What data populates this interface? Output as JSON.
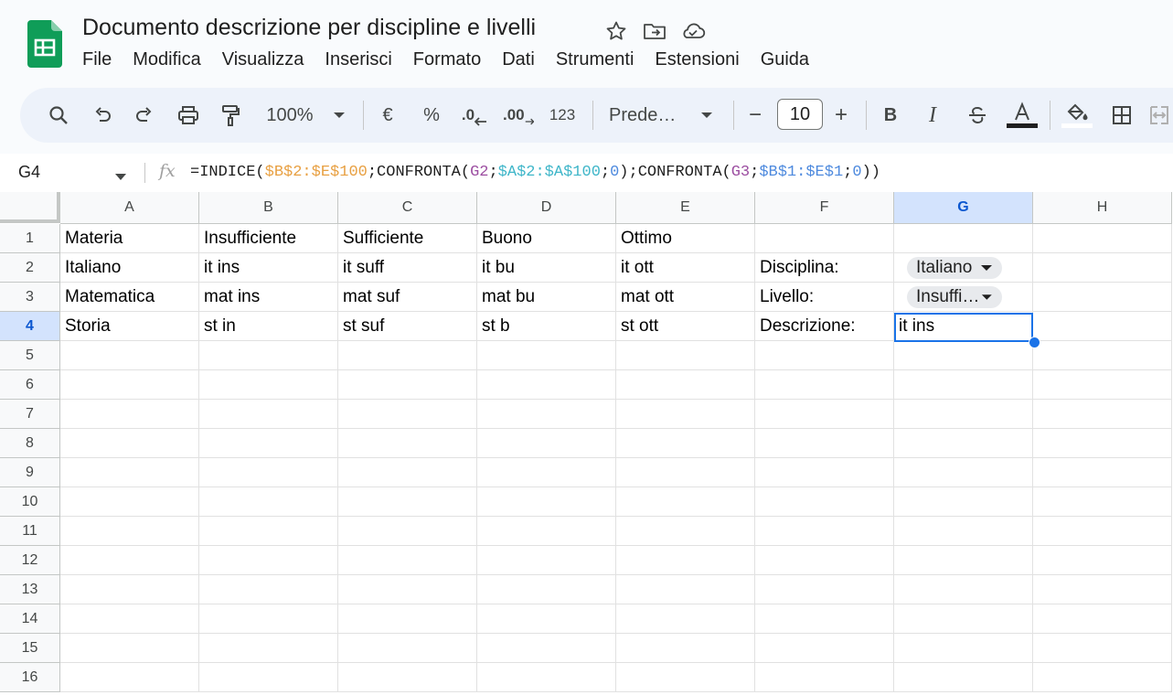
{
  "document": {
    "title": "Documento descrizione per discipline e livelli"
  },
  "menu": [
    "File",
    "Modifica",
    "Visualizza",
    "Inserisci",
    "Formato",
    "Dati",
    "Strumenti",
    "Estensioni",
    "Guida"
  ],
  "toolbar": {
    "zoom": "100%",
    "currency": "€",
    "percent": "%",
    "dec_decrease": ".0",
    "dec_increase": ".00",
    "number_format": "123",
    "font": "Prede…",
    "font_size": "10",
    "minus": "−",
    "plus": "+",
    "bold": "B",
    "italic": "I"
  },
  "formula_bar": {
    "name_box": "G4",
    "fx": "fx",
    "parts": [
      {
        "text": "=INDICE(",
        "color": "dark"
      },
      {
        "text": "$B$2:$E$100",
        "color": "orange"
      },
      {
        "text": ";CONFRONTA(",
        "color": "dark"
      },
      {
        "text": "G2",
        "color": "purple"
      },
      {
        "text": ";",
        "color": "dark"
      },
      {
        "text": "$A$2:$A$100",
        "color": "teal"
      },
      {
        "text": ";",
        "color": "dark"
      },
      {
        "text": "0",
        "color": "blue"
      },
      {
        "text": ");CONFRONTA(",
        "color": "dark"
      },
      {
        "text": "G3",
        "color": "purple"
      },
      {
        "text": ";",
        "color": "dark"
      },
      {
        "text": "$B$1:$E$1",
        "color": "blue"
      },
      {
        "text": ";",
        "color": "dark"
      },
      {
        "text": "0",
        "color": "blue"
      },
      {
        "text": "))",
        "color": "dark"
      }
    ]
  },
  "columns": [
    "A",
    "B",
    "C",
    "D",
    "E",
    "F",
    "G",
    "H"
  ],
  "selected_column": "G",
  "rows": [
    "1",
    "2",
    "3",
    "4",
    "5",
    "6",
    "7",
    "8",
    "9",
    "10",
    "11",
    "12",
    "13",
    "14",
    "15",
    "16"
  ],
  "selected_row": "4",
  "cells": {
    "A1": "Materia",
    "B1": "Insufficiente",
    "C1": "Sufficiente",
    "D1": "Buono",
    "E1": "Ottimo",
    "A2": "Italiano",
    "B2": "it ins",
    "C2": "it suff",
    "D2": "it bu",
    "E2": "it ott",
    "F2": "Disciplina:",
    "A3": "Matematica",
    "B3": "mat ins",
    "C3": "mat suf",
    "D3": "mat bu",
    "E3": "mat ott",
    "F3": "Livello:",
    "A4": "Storia",
    "B4": "st in",
    "C4": "st suf",
    "D4": "st b",
    "E4": "st ott",
    "F4": "Descrizione:",
    "G4": "it ins"
  },
  "dropdowns": {
    "G2": "Italiano",
    "G3": "Insuffic…"
  },
  "colors": {
    "accent": "#1a73e8",
    "sheets_green": "#0f9d58",
    "selected_header": "#d3e3fd"
  }
}
